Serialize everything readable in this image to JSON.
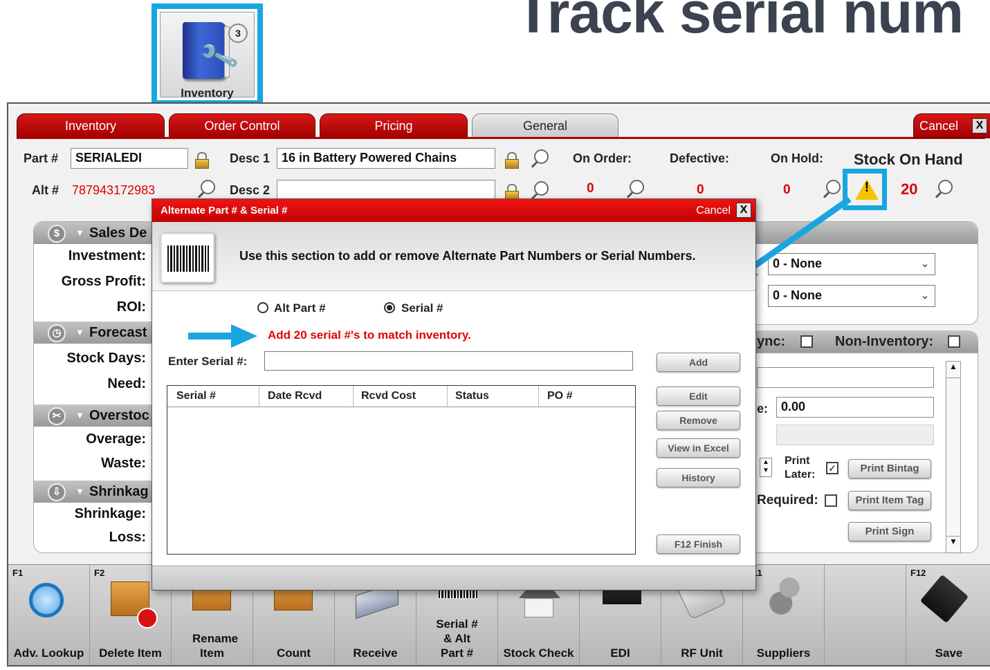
{
  "headline": "Track serial num",
  "inventory_tile": {
    "label": "Inventory",
    "badge": "3"
  },
  "tabs": [
    {
      "label": "Inventory"
    },
    {
      "label": "Order Control"
    },
    {
      "label": "Pricing"
    },
    {
      "label": "General",
      "active": true
    }
  ],
  "cancel_label": "Cancel",
  "close_glyph": "X",
  "part": {
    "part_label": "Part #",
    "part_value": "SERIALEDI",
    "alt_label": "Alt #",
    "alt_value": "787943172983",
    "desc1_label": "Desc 1",
    "desc1_value": "16 in Battery Powered Chains",
    "desc2_label": "Desc 2",
    "desc2_value": ""
  },
  "stats": {
    "on_order_label": "On Order:",
    "on_order_value": "0",
    "defective_label": "Defective:",
    "defective_value": "0",
    "on_hold_label": "On Hold:",
    "on_hold_value": "0",
    "stock_label": "Stock On Hand",
    "stock_value": "20"
  },
  "left_panel": {
    "sales_header": "Sales De",
    "investment": "Investment:",
    "gross_profit": "Gross Profit:",
    "roi": "ROI:",
    "forecast_header": "Forecast",
    "stock_days": "Stock Days:",
    "need": "Need:",
    "overstock_header": "Overstoc",
    "overage": "Overage:",
    "waste": "Waste:",
    "shrinkage_header": "Shrinkag",
    "shrinkage": "Shrinkage:",
    "loss": "Loss:"
  },
  "right_panel": {
    "select1": "0 - None",
    "select2": "0 - None",
    "sync_label": "ync:",
    "non_inventory_label": "Non-Inventory:",
    "price_prefix": "e:",
    "price_value": "0.00",
    "print_later_line1": "Print",
    "print_later_line2": "Later:",
    "print_bintag": "Print Bintag",
    "required_label": "Required:",
    "print_item_tag": "Print Item Tag",
    "print_sign": "Print Sign"
  },
  "dialog": {
    "title": "Alternate Part # & Serial #",
    "cancel": "Cancel",
    "message": "Use this section to add or remove Alternate Part Numbers or Serial Numbers.",
    "radio_alt": "Alt Part #",
    "radio_serial": "Serial #",
    "selected": "Serial #",
    "warning": "Add 20 serial #'s to match inventory.",
    "enter_label": "Enter Serial #:",
    "enter_value": "",
    "columns": [
      "Serial #",
      "Date Rcvd",
      "Rcvd Cost",
      "Status",
      "PO #"
    ],
    "rows": [],
    "buttons": {
      "add": "Add",
      "edit": "Edit",
      "remove": "Remove",
      "view_excel": "View in Excel",
      "history": "History",
      "finish": "F12  Finish"
    }
  },
  "toolbar": [
    {
      "key": "F1",
      "label": "Adv. Lookup",
      "icon": "magnifier-icon"
    },
    {
      "key": "F2",
      "label": "Delete Item",
      "icon": "box-delete-icon"
    },
    {
      "key": "",
      "label": "Rename Item",
      "icon": "box-gear-icon"
    },
    {
      "key": "",
      "label": "Count",
      "icon": "boxes-icon"
    },
    {
      "key": "",
      "label": "Receive",
      "icon": "truck-icon"
    },
    {
      "key": "",
      "label": "Serial # & Alt Part #",
      "icon": "barcode-icon"
    },
    {
      "key": "",
      "label": "Stock Check",
      "icon": "house-check-icon"
    },
    {
      "key": "",
      "label": "EDI",
      "icon": "computer-icon"
    },
    {
      "key": "",
      "label": "RF Unit",
      "icon": "scanner-icon"
    },
    {
      "key": "F11",
      "label": "Suppliers",
      "icon": "people-gear-icon"
    },
    {
      "key": "",
      "label": "",
      "icon": ""
    },
    {
      "key": "F12",
      "label": "Save",
      "icon": "floppy-icon"
    }
  ],
  "colors": {
    "accent_red": "#c80000",
    "highlight_blue": "#19a6e0",
    "warning_red": "#e60000"
  }
}
